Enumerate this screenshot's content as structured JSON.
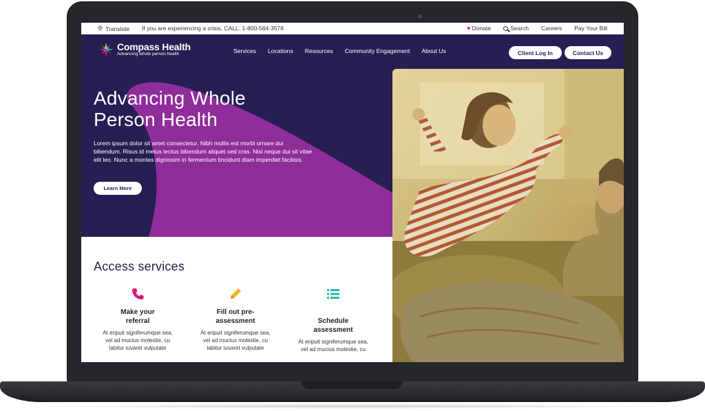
{
  "utility": {
    "translate_label": "Translate",
    "crisis_text": "If you are experiencing a crisis, CALL: 1-800-584-3578",
    "donate_label": "Donate",
    "search_label": "Search",
    "careers_label": "Careers",
    "pay_bill_label": "Pay Your Bill"
  },
  "brand": {
    "name": "Compass Health",
    "tagline": "Advancing whole person health",
    "primary_color": "#271e54",
    "accent_color": "#8f2d9b"
  },
  "nav": {
    "items": [
      {
        "label": "Services"
      },
      {
        "label": "Locations"
      },
      {
        "label": "Resources"
      },
      {
        "label": "Community Engagement"
      },
      {
        "label": "About Us"
      }
    ],
    "login_label": "Client Log In",
    "contact_label": "Contact Us"
  },
  "hero": {
    "title_line1": "Advancing Whole",
    "title_line2": "Person Health",
    "body": "Lorem ipsum dolor sit amet consectetur. Nibh mollis est morbi ornare dui bibendum. Risus id metus lectus bibendum aliquet sed cras. Nisl neque dui sit vitae elit leo. Nunc a montes dignissim in fermentum tincidunt diam imperdiet facilisis.",
    "cta_label": "Learn More"
  },
  "access": {
    "title": "Access services",
    "cards": [
      {
        "icon": "phone-icon",
        "color": "#e0177a",
        "title_line1": "Make your",
        "title_line2": "referral",
        "body": "At eripuit signiferumque sea, vel ad mucius molestie, cu labitur iuvaret vulputate"
      },
      {
        "icon": "pencil-icon",
        "color": "#f2b233",
        "title_line1": "Fill out pre-",
        "title_line2": "assessment",
        "body": "At eripuit signiferumque sea, vel ad mucius molestie, cu labitur iuvaret vulputate"
      },
      {
        "icon": "list-icon",
        "color": "#2bb5a8",
        "title_line1": "Schedule",
        "title_line2": "assessment",
        "body": "At eripuit signiferumque sea, vel ad mucius molestie, cu"
      }
    ]
  }
}
